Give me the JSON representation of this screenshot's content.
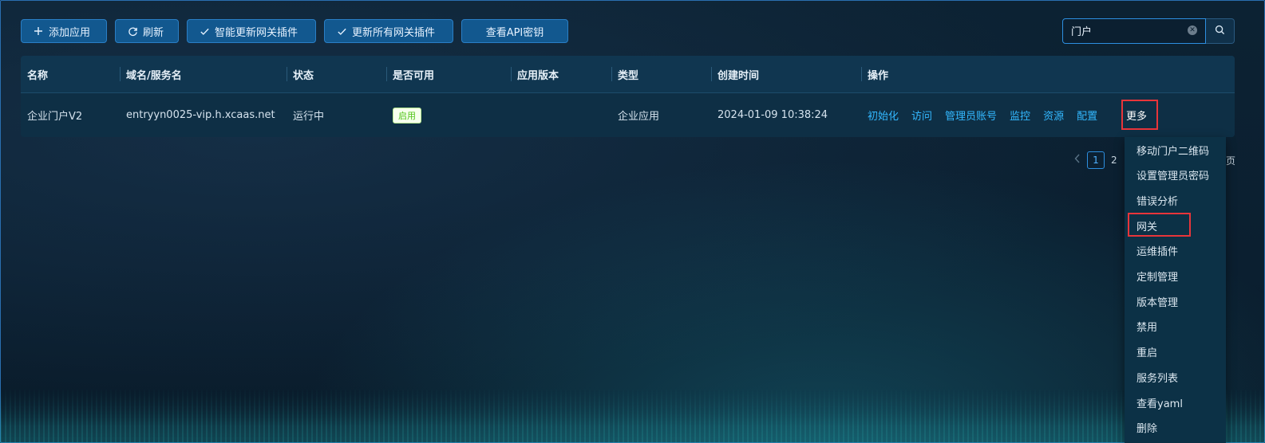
{
  "toolbar": {
    "add_app": "添加应用",
    "refresh": "刷新",
    "smart_update": "智能更新网关插件",
    "update_all": "更新所有网关插件",
    "view_api_key": "查看API密钥"
  },
  "search": {
    "value": "门户"
  },
  "table": {
    "columns": [
      "名称",
      "域名/服务名",
      "状态",
      "是否可用",
      "应用版本",
      "类型",
      "创建时间",
      "操作"
    ],
    "rows": [
      {
        "name": "企业门户V2",
        "domain": "entryyn0025-vip.h.xcaas.net",
        "status": "运行中",
        "available": "启用",
        "version": "",
        "type": "企业应用",
        "created": "2024-01-09 10:38:24"
      }
    ],
    "actions": [
      "初始化",
      "访问",
      "管理员账号",
      "监控",
      "资源",
      "配置",
      "更多"
    ]
  },
  "pagination": {
    "current": "1",
    "next": "2",
    "suffix": "页"
  },
  "more_menu": {
    "items": [
      "移动门户二维码",
      "设置管理员密码",
      "错误分析",
      "网关",
      "运维插件",
      "定制管理",
      "版本管理",
      "禁用",
      "重启",
      "服务列表",
      "查看yaml",
      "删除"
    ],
    "highlighted": "网关"
  },
  "colors": {
    "accent": "#33b8ff",
    "button": "#12588f",
    "highlight_border": "#e8353a",
    "tag_green": "#52c41a"
  }
}
